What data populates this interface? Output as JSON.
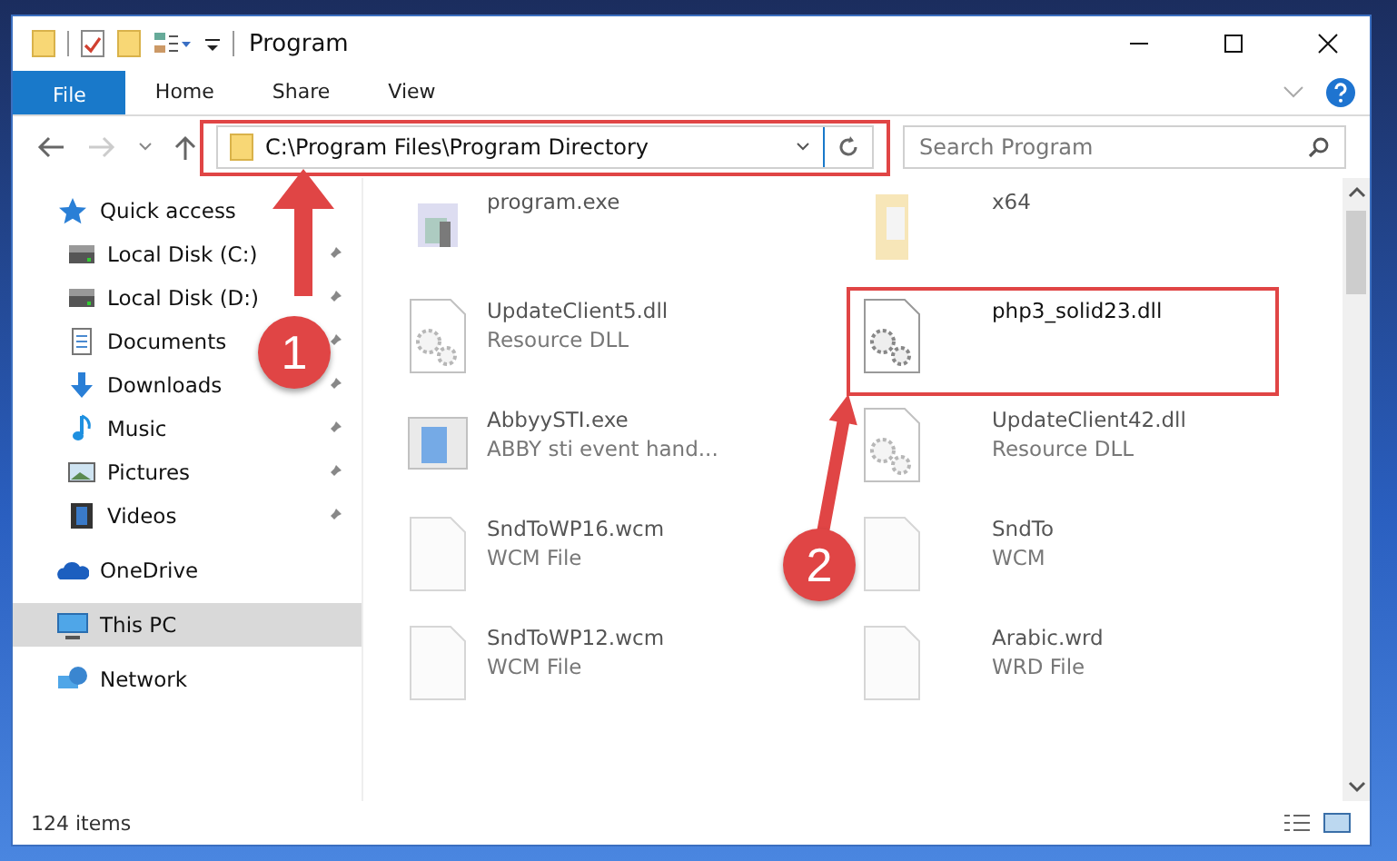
{
  "window": {
    "title": "Program"
  },
  "ribbon_tabs": [
    {
      "label": "File",
      "kind": "file",
      "selected": false
    },
    {
      "label": "Home",
      "kind": "tab",
      "selected": false
    },
    {
      "label": "Share",
      "kind": "tab",
      "selected": false
    },
    {
      "label": "View",
      "kind": "tab",
      "selected": false
    }
  ],
  "address": {
    "path": "C:\\Program Files\\Program Directory"
  },
  "search": {
    "placeholder": "Search Program"
  },
  "sidebar": {
    "items": [
      {
        "label": "Quick access",
        "kind": "star",
        "selected": false,
        "children": [
          {
            "label": "Local Disk (C:)",
            "kind": "drive",
            "pinned": true,
            "selected": false
          },
          {
            "label": "Local Disk (D:)",
            "kind": "drive",
            "pinned": true,
            "selected": false
          },
          {
            "label": "Documents",
            "kind": "doc",
            "pinned": true,
            "selected": false
          },
          {
            "label": "Downloads",
            "kind": "download",
            "pinned": true,
            "selected": false
          },
          {
            "label": "Music",
            "kind": "music",
            "pinned": true,
            "selected": false
          },
          {
            "label": "Pictures",
            "kind": "pictures",
            "pinned": true,
            "selected": false
          },
          {
            "label": "Videos",
            "kind": "videos",
            "pinned": true,
            "selected": false
          }
        ]
      },
      {
        "label": "OneDrive",
        "kind": "cloud",
        "selected": false
      },
      {
        "label": "This PC",
        "kind": "pc",
        "selected": true
      },
      {
        "label": "Network",
        "kind": "network",
        "selected": false
      }
    ]
  },
  "files": [
    {
      "name": "program.exe",
      "kind": "exe",
      "blurred": true,
      "highlighted": false
    },
    {
      "name": "x64",
      "kind": "folder",
      "blurred": true,
      "highlighted": false
    },
    {
      "name": "UpdateClient5.dll",
      "type": "Resource DLL",
      "kind": "dll",
      "blurred": true,
      "highlighted": false
    },
    {
      "name": "php3_solid23.dll",
      "kind": "dll",
      "blurred": false,
      "highlighted": true
    },
    {
      "name": "AbbyySTI.exe",
      "type": "ABBY sti event hand...",
      "kind": "app",
      "blurred": true,
      "highlighted": false
    },
    {
      "name": "UpdateClient42.dll",
      "type": "Resource DLL",
      "kind": "dll",
      "blurred": true,
      "highlighted": false
    },
    {
      "name": "SndToWP16.wcm",
      "type": "WCM File",
      "kind": "blank",
      "blurred": true,
      "highlighted": false
    },
    {
      "name": "SndTo",
      "type": "WCM",
      "kind": "blank",
      "blurred": true,
      "highlighted": false
    },
    {
      "name": "SndToWP12.wcm",
      "type": "WCM File",
      "kind": "blank",
      "blurred": true,
      "highlighted": false
    },
    {
      "name": "Arabic.wrd",
      "type": "WRD File",
      "kind": "blank",
      "blurred": true,
      "highlighted": false
    }
  ],
  "status_bar": {
    "count": "124 items"
  },
  "annotations": [
    {
      "number": "1"
    },
    {
      "number": "2"
    }
  ]
}
